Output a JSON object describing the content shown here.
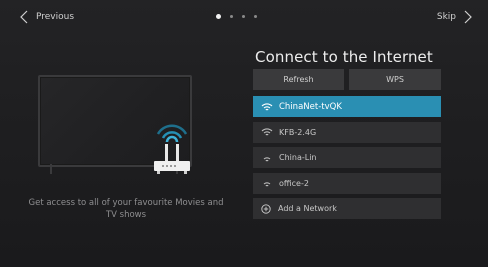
{
  "nav": {
    "previous_label": "Previous",
    "skip_label": "Skip"
  },
  "pager": {
    "total": 4,
    "current": 1
  },
  "left": {
    "tagline": "Get access to all of your favourite Movies and TV shows"
  },
  "panel": {
    "title": "Connect to the Internet",
    "refresh_label": "Refresh",
    "wps_label": "WPS",
    "networks": [
      {
        "name": "ChinaNet-tvQK",
        "selected": true,
        "icon": "wifi-icon"
      },
      {
        "name": "KFB-2.4G",
        "selected": false,
        "icon": "wifi-icon"
      },
      {
        "name": "China-Lin",
        "selected": false,
        "icon": "wifi-icon"
      },
      {
        "name": "office-2",
        "selected": false,
        "icon": "wifi-icon"
      }
    ],
    "add_network_label": "Add a Network",
    "add_network_icon": "plus-circle-icon"
  },
  "colors": {
    "accent": "#2a8fb3",
    "background": "#1f1f21",
    "item": "#2f2f31",
    "button": "#3a3a3c"
  }
}
